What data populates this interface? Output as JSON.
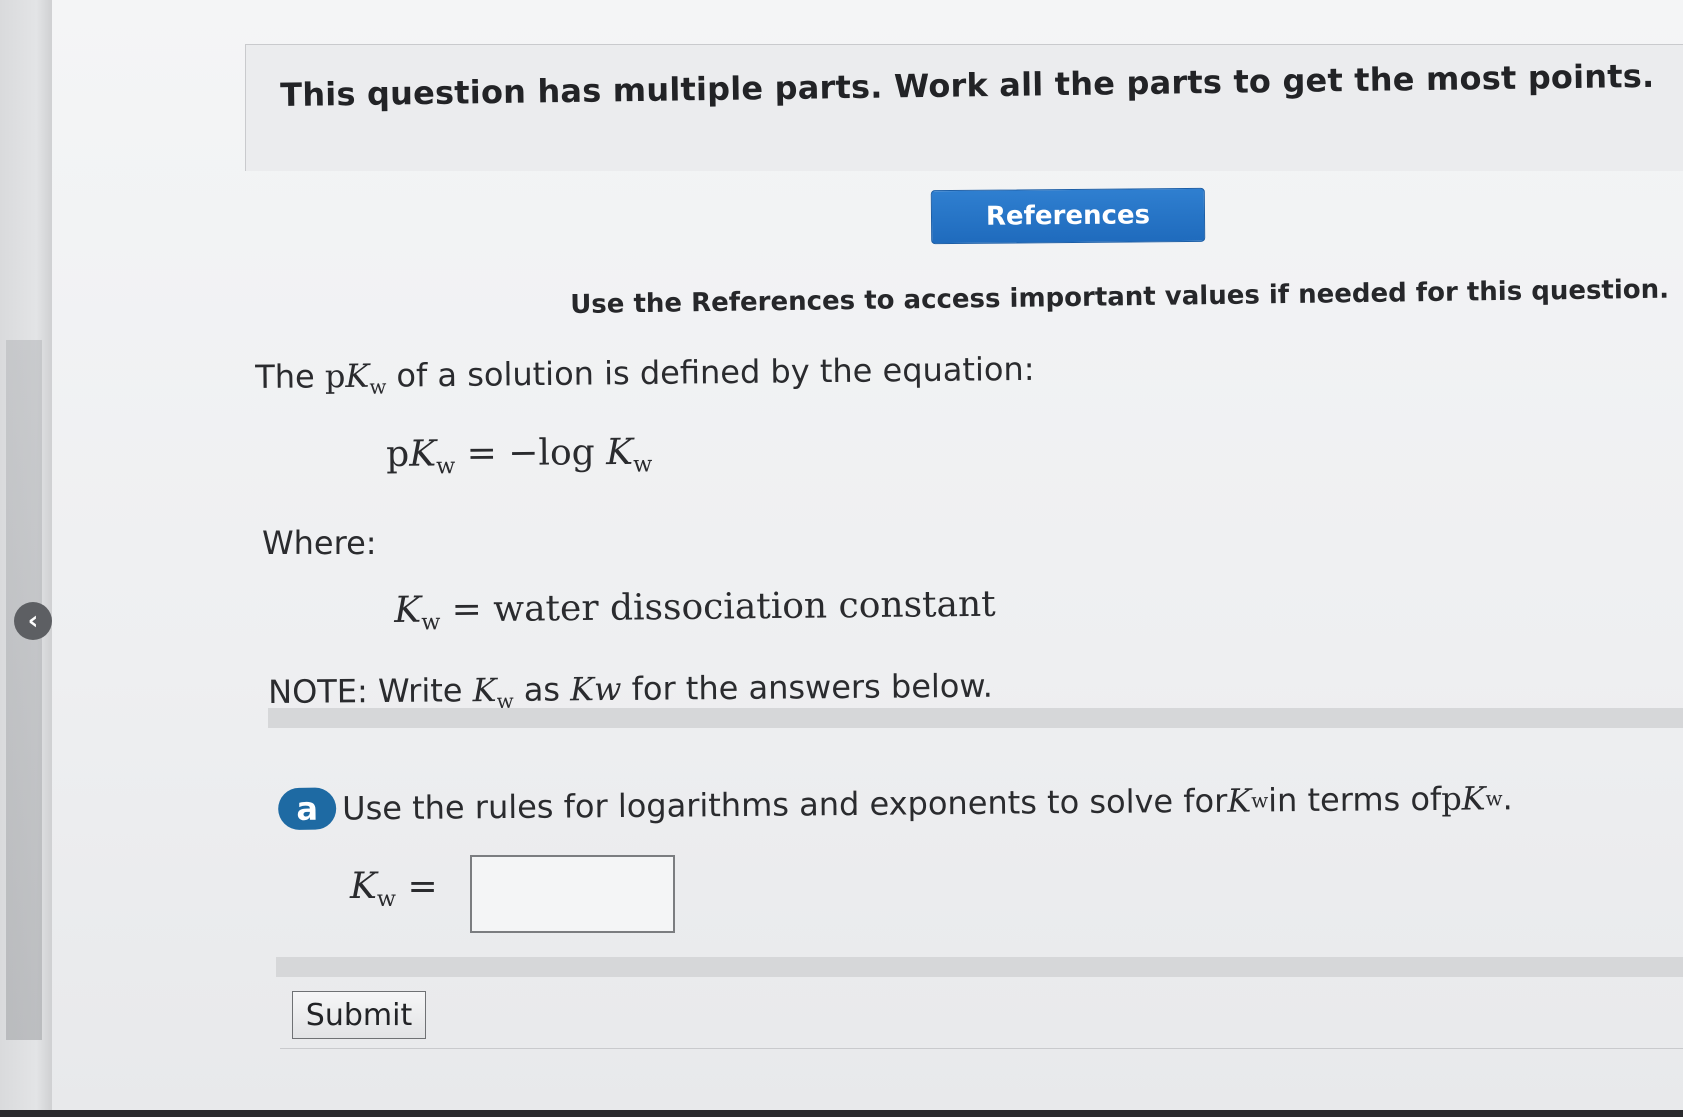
{
  "header": {
    "title": "This question has multiple parts. Work all the parts to get the most points."
  },
  "references": {
    "button_label": "References",
    "note": "Use the References to access important values if needed for this question."
  },
  "problem": {
    "intro_before": "The ",
    "intro_p": "p",
    "intro_K": "K",
    "intro_sub": "w",
    "intro_after": " of a solution is defined by the equation:",
    "eq1_p": "p",
    "eq1_K": "K",
    "eq1_sub": "w",
    "eq1_mid": " = −log ",
    "eq1_K2": "K",
    "eq1_sub2": "w",
    "where_label": "Where:",
    "eq2_K": "K",
    "eq2_sub": "w",
    "eq2_rest": " = water dissociation constant",
    "note_before": "NOTE: Write ",
    "note_K": "K",
    "note_sub": "w",
    "note_as": " as ",
    "note_Kw": "Kw",
    "note_after": " for the answers below."
  },
  "part_a": {
    "badge": "a",
    "text_before": "Use the rules for logarithms and exponents to solve for ",
    "text_K": "K",
    "text_sub": "w",
    "text_middle": " in terms of ",
    "text_p": "p",
    "text_K2": "K",
    "text_sub2": "w",
    "text_end": " .",
    "answer_K": "K",
    "answer_sub": "w",
    "answer_eq": " =",
    "answer_value": ""
  },
  "submit": {
    "label": "Submit"
  },
  "nav": {
    "back_glyph": "‹"
  }
}
